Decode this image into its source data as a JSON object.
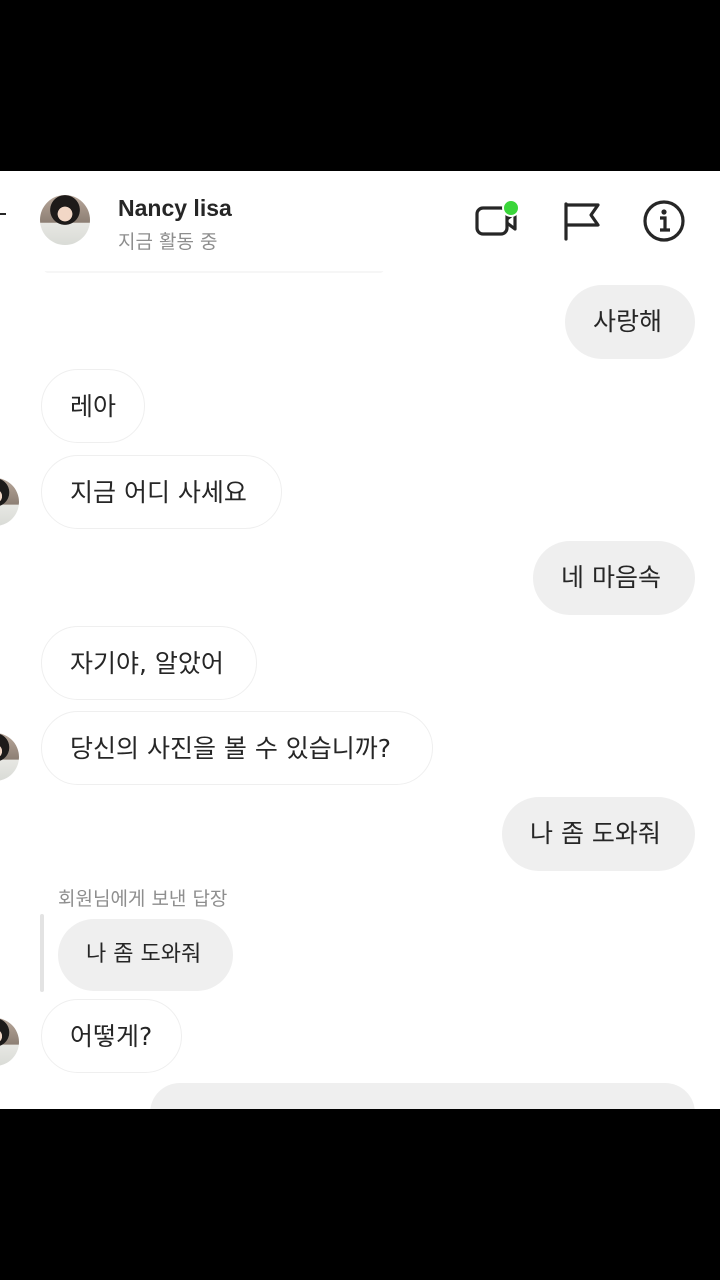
{
  "header": {
    "contact_name": "Nancy lisa",
    "status": "지금 활동 중",
    "icons": [
      "video-call-icon",
      "flag-icon",
      "info-icon"
    ],
    "online_color": "#3ad63a"
  },
  "messages": [
    {
      "side": "sent",
      "text": "사랑해"
    },
    {
      "side": "received",
      "text": "레아"
    },
    {
      "side": "received",
      "text": "지금 어디 사세요"
    },
    {
      "side": "sent",
      "text": "네 마음속"
    },
    {
      "side": "received",
      "text": "자기야, 알았어"
    },
    {
      "side": "received",
      "text": "당신의 사진을 볼 수 있습니까?"
    },
    {
      "side": "sent",
      "text": "나 좀 도와줘"
    },
    {
      "side": "received",
      "text": "어떻게?",
      "reply": {
        "label": "회원님에게 보낸 답장",
        "quoted": "나 좀 도와줘"
      }
    }
  ],
  "colors": {
    "sent_bubble": "#efefef",
    "received_border": "#efefef",
    "text": "#262626",
    "muted": "#8e8e8e"
  }
}
